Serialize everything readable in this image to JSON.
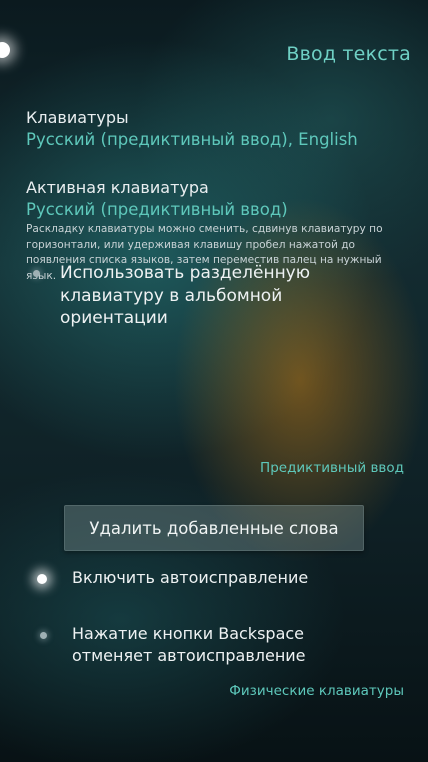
{
  "header": {
    "title": "Ввод текста"
  },
  "keyboards": {
    "label": "Клавиатуры",
    "value": "Русский (предиктивный ввод), English"
  },
  "active_keyboard": {
    "label": "Активная клавиатура",
    "value": "Русский (предиктивный ввод)",
    "description": "Раскладку клавиатуры можно сменить, сдвинув клавиатуру по горизонтали, или удерживая клавишу пробел нажатой до появления списка языков, затем переместив палец на нужный язык."
  },
  "split_keyboard": {
    "label": "Использовать разделённую клавиатуру в альбомной ориентации",
    "enabled": false
  },
  "predictive": {
    "header": "Предиктивный ввод",
    "delete_words_button": "Удалить добавленные слова"
  },
  "autocorrect": {
    "label": "Включить автоисправление",
    "enabled": true
  },
  "backspace_undo": {
    "label": "Нажатие кнопки Backspace отменяет автоисправление",
    "enabled": false
  },
  "physical": {
    "header": "Физические клавиатуры"
  }
}
